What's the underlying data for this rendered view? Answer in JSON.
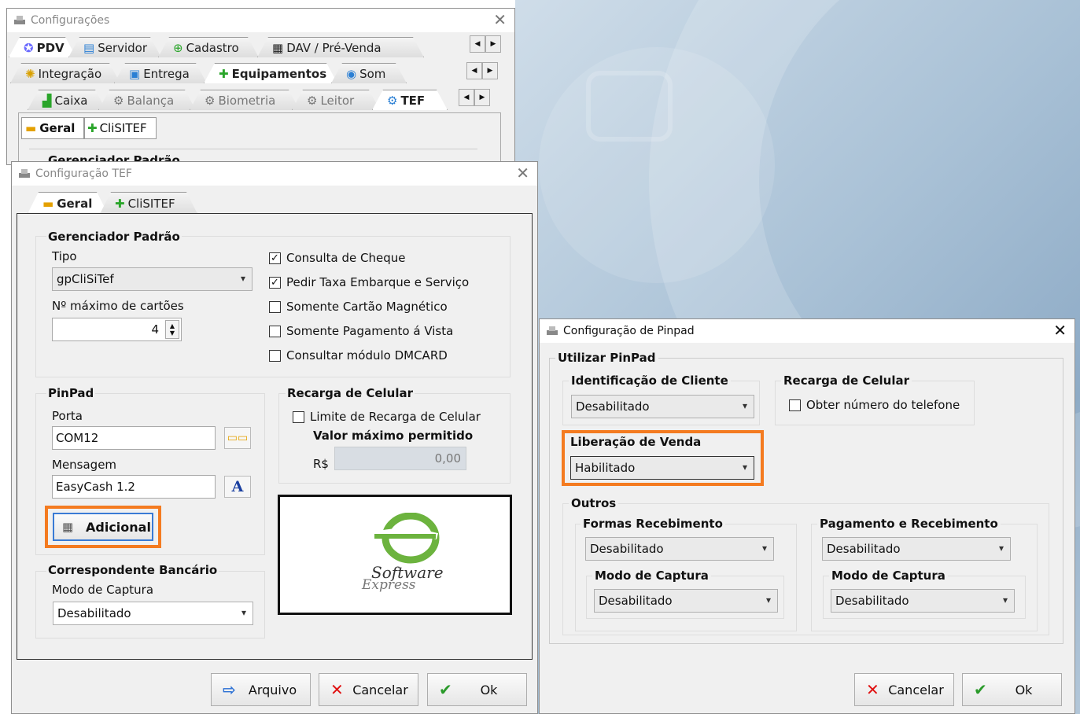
{
  "config": {
    "title": "Configurações",
    "tabs_row1": [
      "PDV",
      "Servidor",
      "Cadastro",
      "DAV / Pré-Venda"
    ],
    "tabs_row2": [
      "Integração",
      "Entrega",
      "Equipamentos",
      "Som"
    ],
    "tabs_row3": [
      "Caixa",
      "Balança",
      "Biometria",
      "Leitor",
      "TEF"
    ],
    "tabs_row4": [
      "Geral",
      "CliSITEF"
    ],
    "group_cut": "Gerenciador Padrão"
  },
  "tef": {
    "title": "Configuração TEF",
    "tabs": [
      "Geral",
      "CliSITEF"
    ],
    "gerenciador": {
      "title": "Gerenciador Padrão",
      "tipo_label": "Tipo",
      "tipo_value": "gpCliSiTef",
      "max_cartoes_label": "Nº máximo de cartões",
      "max_cartoes_value": "4"
    },
    "checks": [
      {
        "label": "Consulta de Cheque",
        "checked": true
      },
      {
        "label": "Pedir Taxa Embarque e Serviço",
        "checked": true
      },
      {
        "label": "Somente Cartão Magnético",
        "checked": false
      },
      {
        "label": "Somente Pagamento á Vista",
        "checked": false
      },
      {
        "label": "Consultar módulo DMCARD",
        "checked": false
      }
    ],
    "pinpad": {
      "title": "PinPad",
      "porta_label": "Porta",
      "porta_value": "COM12",
      "mensagem_label": "Mensagem",
      "mensagem_value": "EasyCash 1.2",
      "adicional_label": "Adicional"
    },
    "recarga": {
      "title": "Recarga de Celular",
      "limite_label": "Limite de Recarga de Celular",
      "valor_label": "Valor máximo permitido",
      "currency": "R$",
      "valor_value": "0,00"
    },
    "logo": {
      "line1": "Software",
      "line2": "Express"
    },
    "correspondente": {
      "title": "Correspondente Bancário",
      "modo_label": "Modo de Captura",
      "modo_value": "Desabilitado"
    },
    "buttons": {
      "arquivo": "Arquivo",
      "cancelar": "Cancelar",
      "ok": "Ok"
    }
  },
  "pinpad": {
    "title": "Configuração de Pinpad",
    "utilizar": "Utilizar PinPad",
    "identificacao": {
      "title": "Identificação de Cliente",
      "value": "Desabilitado"
    },
    "recarga": {
      "title": "Recarga de Celular",
      "check_label": "Obter número do telefone"
    },
    "liberacao": {
      "title": "Liberação de Venda",
      "value": "Habilitado"
    },
    "outros": {
      "title": "Outros",
      "formas": {
        "title": "Formas Recebimento",
        "value": "Desabilitado",
        "modo_title": "Modo de Captura",
        "modo_value": "Desabilitado"
      },
      "pagamento": {
        "title": "Pagamento e Recebimento",
        "value": "Desabilitado",
        "modo_title": "Modo de Captura",
        "modo_value": "Desabilitado"
      }
    },
    "buttons": {
      "cancelar": "Cancelar",
      "ok": "Ok"
    }
  },
  "colors": {
    "highlight": "#f47b20",
    "accent": "#0078d7"
  }
}
